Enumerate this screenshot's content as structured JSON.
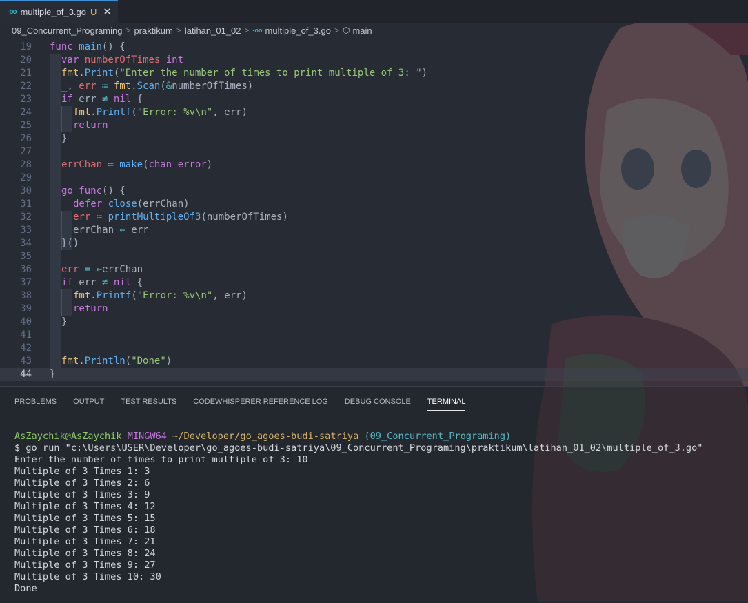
{
  "tab": {
    "filename": "multiple_of_3.go",
    "status": "U",
    "icon": "go-file-icon",
    "close": "✕"
  },
  "breadcrumb": {
    "items": [
      "09_Concurrent_Programing",
      "praktikum",
      "latihan_01_02",
      "multiple_of_3.go",
      "main"
    ]
  },
  "editor": {
    "lines": [
      {
        "n": "19",
        "t": [
          [
            "kw",
            "func "
          ],
          [
            "fn",
            "main"
          ],
          [
            "plain",
            "() {"
          ]
        ]
      },
      {
        "n": "20",
        "t": [
          [
            "kw",
            "var "
          ],
          [
            "var",
            "numberOfTimes "
          ],
          [
            "kw",
            "int"
          ]
        ]
      },
      {
        "n": "21",
        "t": [
          [
            "pkg",
            "fmt"
          ],
          [
            "plain",
            "."
          ],
          [
            "fn",
            "Print"
          ],
          [
            "plain",
            "("
          ],
          [
            "str",
            "\"Enter the number of times to print multiple of 3: \""
          ],
          [
            "plain",
            ")"
          ]
        ]
      },
      {
        "n": "22",
        "t": [
          [
            "var",
            "_"
          ],
          [
            "plain",
            ", "
          ],
          [
            "var",
            "err "
          ],
          [
            "op",
            "≔ "
          ],
          [
            "pkg",
            "fmt"
          ],
          [
            "plain",
            "."
          ],
          [
            "fn",
            "Scan"
          ],
          [
            "plain",
            "("
          ],
          [
            "op",
            "&"
          ],
          [
            "plain",
            "numberOfTimes)"
          ]
        ]
      },
      {
        "n": "23",
        "t": [
          [
            "kw",
            "if "
          ],
          [
            "plain",
            "err "
          ],
          [
            "op",
            "≠ "
          ],
          [
            "kw",
            "nil "
          ],
          [
            "plain",
            "{"
          ]
        ]
      },
      {
        "n": "24",
        "t": [
          [
            "pkg",
            "fmt"
          ],
          [
            "plain",
            "."
          ],
          [
            "fn",
            "Printf"
          ],
          [
            "plain",
            "("
          ],
          [
            "str",
            "\"Error: %v\\n\""
          ],
          [
            "plain",
            ", err)"
          ]
        ]
      },
      {
        "n": "25",
        "t": [
          [
            "kw",
            "return"
          ]
        ]
      },
      {
        "n": "26",
        "t": [
          [
            "plain",
            "}"
          ]
        ]
      },
      {
        "n": "27",
        "t": []
      },
      {
        "n": "28",
        "t": [
          [
            "var",
            "errChan "
          ],
          [
            "op",
            "≔ "
          ],
          [
            "fn",
            "make"
          ],
          [
            "plain",
            "("
          ],
          [
            "kw",
            "chan "
          ],
          [
            "kw",
            "error"
          ],
          [
            "plain",
            ")"
          ]
        ]
      },
      {
        "n": "29",
        "t": []
      },
      {
        "n": "30",
        "t": [
          [
            "kw",
            "go "
          ],
          [
            "kw",
            "func"
          ],
          [
            "plain",
            "() {"
          ]
        ]
      },
      {
        "n": "31",
        "t": [
          [
            "kw",
            "defer "
          ],
          [
            "fn",
            "close"
          ],
          [
            "plain",
            "(errChan)"
          ]
        ]
      },
      {
        "n": "32",
        "t": [
          [
            "var",
            "err "
          ],
          [
            "op",
            "≔ "
          ],
          [
            "fn",
            "printMultipleOf3"
          ],
          [
            "plain",
            "(numberOfTimes)"
          ]
        ]
      },
      {
        "n": "33",
        "t": [
          [
            "plain",
            "errChan "
          ],
          [
            "op",
            "← "
          ],
          [
            "plain",
            "err"
          ]
        ]
      },
      {
        "n": "34",
        "t": [
          [
            "plain",
            "}()"
          ]
        ]
      },
      {
        "n": "35",
        "t": []
      },
      {
        "n": "36",
        "t": [
          [
            "var",
            "err "
          ],
          [
            "op",
            "= ←"
          ],
          [
            "plain",
            "errChan"
          ]
        ]
      },
      {
        "n": "37",
        "t": [
          [
            "kw",
            "if "
          ],
          [
            "plain",
            "err "
          ],
          [
            "op",
            "≠ "
          ],
          [
            "kw",
            "nil "
          ],
          [
            "plain",
            "{"
          ]
        ]
      },
      {
        "n": "38",
        "t": [
          [
            "pkg",
            "fmt"
          ],
          [
            "plain",
            "."
          ],
          [
            "fn",
            "Printf"
          ],
          [
            "plain",
            "("
          ],
          [
            "str",
            "\"Error: %v\\n\""
          ],
          [
            "plain",
            ", err)"
          ]
        ]
      },
      {
        "n": "39",
        "t": [
          [
            "kw",
            "return"
          ]
        ]
      },
      {
        "n": "40",
        "t": [
          [
            "plain",
            "}"
          ]
        ]
      },
      {
        "n": "41",
        "t": []
      },
      {
        "n": "42",
        "t": []
      },
      {
        "n": "43",
        "t": [
          [
            "pkg",
            "fmt"
          ],
          [
            "plain",
            "."
          ],
          [
            "fn",
            "Println"
          ],
          [
            "plain",
            "("
          ],
          [
            "str",
            "\"Done\""
          ],
          [
            "plain",
            ")"
          ]
        ]
      },
      {
        "n": "44",
        "t": [
          [
            "plain",
            "}"
          ]
        ]
      }
    ]
  },
  "panel": {
    "tabs": [
      "PROBLEMS",
      "OUTPUT",
      "TEST RESULTS",
      "CODEWHISPERER REFERENCE LOG",
      "DEBUG CONSOLE",
      "TERMINAL"
    ],
    "active_tab": "TERMINAL"
  },
  "terminal": {
    "prompt_user": "AsZaychik@AsZaychik",
    "prompt_env": "MINGW64",
    "prompt_path": "~/Developer/go_agoes-budi-satriya",
    "prompt_branch": "(09_Concurrent_Programing)",
    "command": "$ go run \"c:\\Users\\USER\\Developer\\go_agoes-budi-satriya\\09_Concurrent_Programing\\praktikum\\latihan_01_02\\multiple_of_3.go\"",
    "output": [
      "Enter the number of times to print multiple of 3: 10",
      "Multiple of 3 Times 1: 3",
      "Multiple of 3 Times 2: 6",
      "Multiple of 3 Times 3: 9",
      "Multiple of 3 Times 4: 12",
      "Multiple of 3 Times 5: 15",
      "Multiple of 3 Times 6: 18",
      "Multiple of 3 Times 7: 21",
      "Multiple of 3 Times 8: 24",
      "Multiple of 3 Times 9: 27",
      "Multiple of 3 Times 10: 30",
      "Done"
    ]
  }
}
